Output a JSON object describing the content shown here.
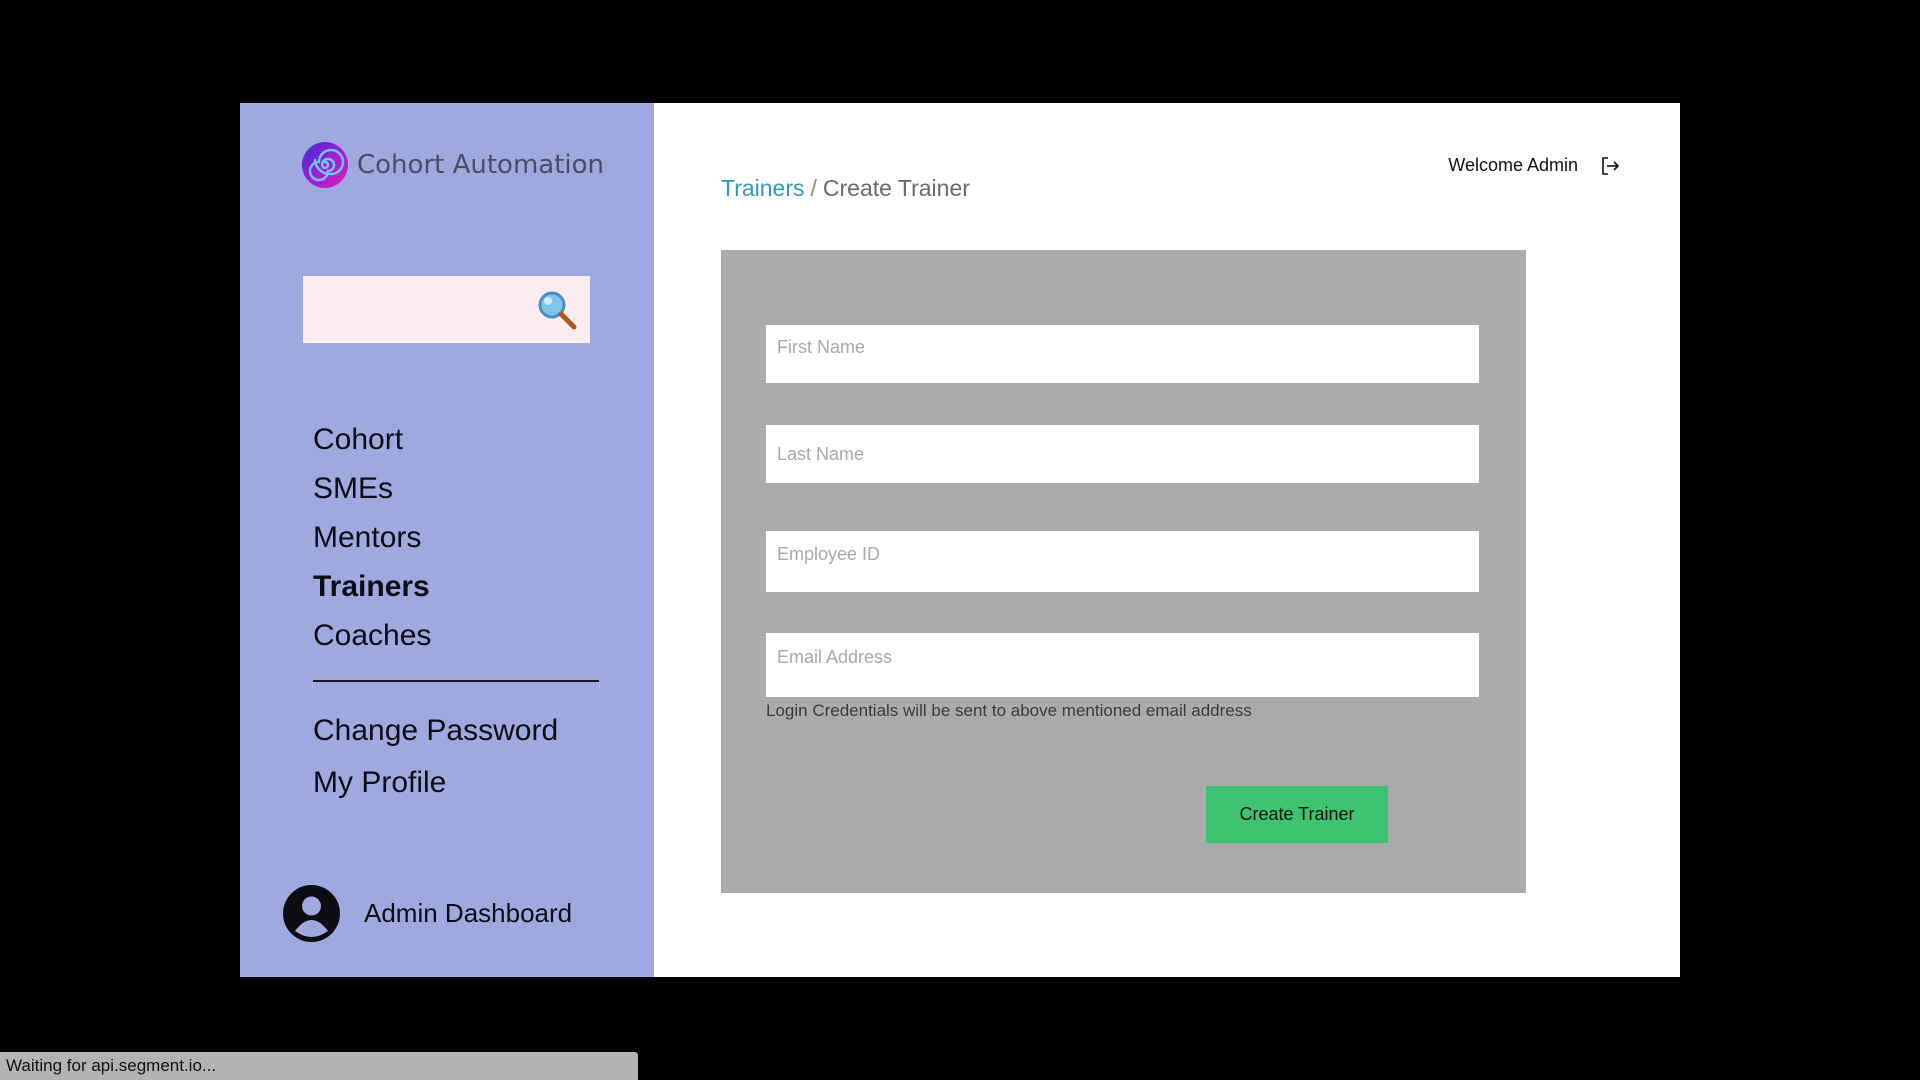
{
  "app": {
    "brand_name": "Cohort Automation"
  },
  "sidebar": {
    "search": {
      "placeholder": "",
      "value": "",
      "icon": "magnifier-icon"
    },
    "nav_items": [
      {
        "label": "Cohort",
        "active": false
      },
      {
        "label": "SMEs",
        "active": false
      },
      {
        "label": "Mentors",
        "active": false
      },
      {
        "label": "Trainers",
        "active": true
      },
      {
        "label": "Coaches",
        "active": false
      }
    ],
    "account_items": [
      {
        "label": "Change Password"
      },
      {
        "label": "My Profile"
      }
    ],
    "user": {
      "label": "Admin Dashboard",
      "icon": "user-circle-icon"
    }
  },
  "header": {
    "breadcrumb": {
      "parent": "Trainers",
      "separator": "/",
      "current": "Create Trainer"
    },
    "welcome": "Welcome Admin",
    "logout_icon": "logout-icon"
  },
  "form": {
    "first_name": {
      "placeholder": "First Name",
      "value": ""
    },
    "last_name": {
      "placeholder": "Last Name",
      "value": ""
    },
    "employee_id": {
      "placeholder": "Employee ID",
      "value": ""
    },
    "email": {
      "placeholder": "Email Address",
      "value": ""
    },
    "email_hint": "Login Credentials will be sent to above mentioned email address",
    "submit_label": "Create Trainer"
  },
  "status_bar": {
    "text": "Waiting for api.segment.io..."
  },
  "colors": {
    "sidebar_bg": "#9ea9df",
    "panel_bg": "#aaacac",
    "link": "#2f9cb7",
    "submit_bg": "#3ec470"
  }
}
